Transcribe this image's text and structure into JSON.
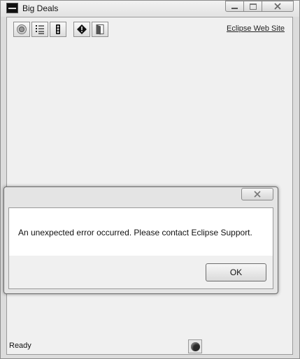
{
  "window": {
    "title": "Big Deals",
    "controls": {
      "minimize": "minimize",
      "maximize": "maximize",
      "close": "close"
    }
  },
  "toolbar": {
    "buttons": [
      {
        "icon": "refresh-icon"
      },
      {
        "icon": "list-icon"
      },
      {
        "icon": "traffic-light-icon"
      },
      {
        "icon": "info-diamond-icon"
      },
      {
        "icon": "exit-door-icon"
      }
    ],
    "web_link": "Eclipse Web Site"
  },
  "status": {
    "text": "Ready",
    "indicator_icon": "status-knob-icon"
  },
  "dialog": {
    "close_glyph": "☒",
    "message": "An unexpected error occurred. Please contact Eclipse Support.",
    "ok_label": "OK"
  }
}
